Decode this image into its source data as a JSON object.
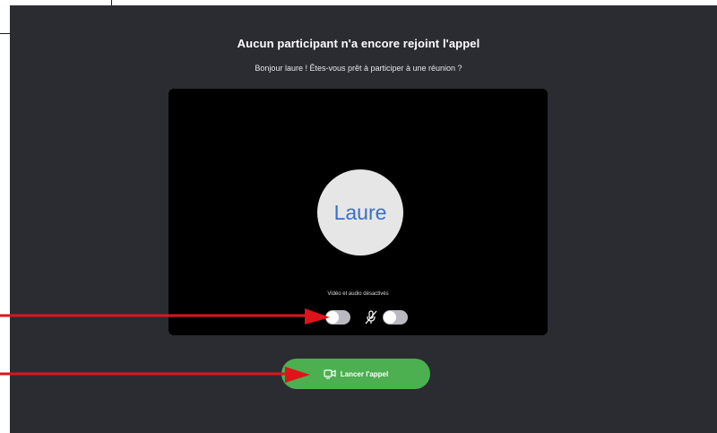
{
  "header": {
    "title": "Aucun participant n'a encore rejoint l'appel",
    "subtitle": "Bonjour laure ! Êtes-vous prêt à participer à une réunion ?"
  },
  "preview": {
    "avatar_label": "Laure",
    "status_text": "Vidéo et audio désactivés",
    "camera_enabled": false,
    "microphone_enabled": false
  },
  "actions": {
    "launch_label": "Lancer l'appel"
  },
  "colors": {
    "background": "#2b2b32",
    "preview_bg": "#000000",
    "accent_green": "#4caf50",
    "avatar_text": "#3a6fc4",
    "annotation_arrow": "#e0131b"
  },
  "icons": {
    "microphone": "microphone-muted-icon",
    "launch": "video-camera-icon"
  }
}
